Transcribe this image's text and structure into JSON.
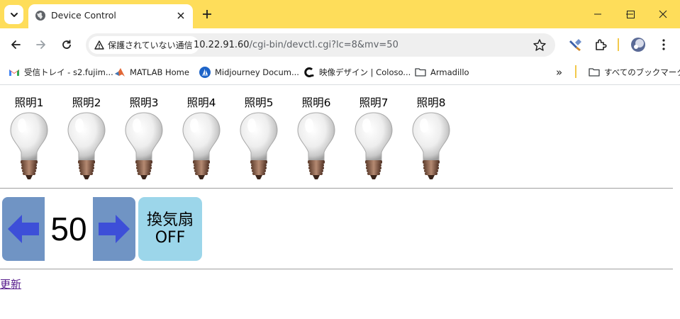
{
  "browser": {
    "tab": {
      "title": "Device Control"
    },
    "address": {
      "security_label": "保護されていない通信",
      "host": "10.22.91.60",
      "path": "/cgi-bin/devctl.cgi?lc=8&mv=50"
    },
    "bookmarks": [
      {
        "label": "受信トレイ - s2.fujim...",
        "icon": "gmail-icon"
      },
      {
        "label": "MATLAB Home",
        "icon": "matlab-icon"
      },
      {
        "label": "Midjourney Docum...",
        "icon": "midjourney-icon"
      },
      {
        "label": "映像デザイン | Coloso...",
        "icon": "coloso-icon"
      },
      {
        "label": "Armadillo",
        "icon": "folder-icon"
      }
    ],
    "bookmarks_overflow": "»",
    "all_bookmarks_label": "すべてのブックマーク",
    "colors": {
      "tabstrip": "#fedd5a"
    }
  },
  "page": {
    "lights": [
      {
        "label": "照明1",
        "state": "off"
      },
      {
        "label": "照明2",
        "state": "off"
      },
      {
        "label": "照明3",
        "state": "off"
      },
      {
        "label": "照明4",
        "state": "off"
      },
      {
        "label": "照明5",
        "state": "off"
      },
      {
        "label": "照明6",
        "state": "off"
      },
      {
        "label": "照明7",
        "state": "off"
      },
      {
        "label": "照明8",
        "state": "off"
      }
    ],
    "level_value": "50",
    "fan": {
      "name": "換気扇",
      "state": "OFF"
    },
    "refresh_label": "更新",
    "colors": {
      "arrow_button": "#7094c4",
      "arrow": "#3d4fd8",
      "fan_button": "#9cd6ea"
    }
  }
}
